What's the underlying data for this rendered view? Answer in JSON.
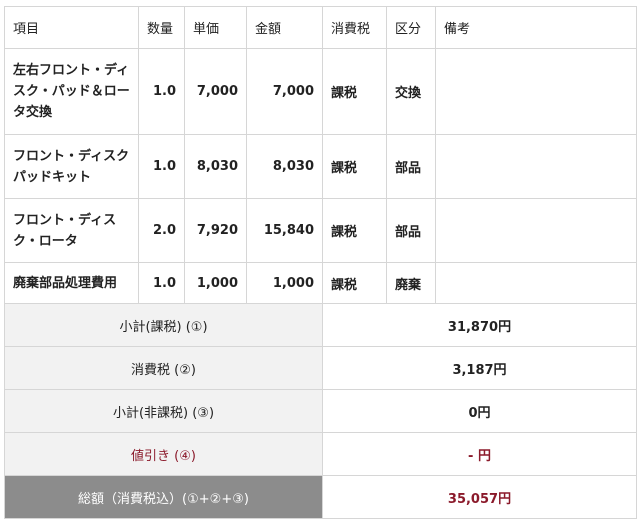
{
  "headers": [
    "項目",
    "数量",
    "単価",
    "金額",
    "消費税",
    "区分",
    "備考"
  ],
  "items": [
    {
      "name": "左右フロント・ディスク・パッド＆ロータ交換",
      "qty": "1.0",
      "unit_price": "7,000",
      "amount": "7,000",
      "tax": "課税",
      "category": "交換",
      "note": ""
    },
    {
      "name": "フロント・ディスクパッドキット",
      "qty": "1.0",
      "unit_price": "8,030",
      "amount": "8,030",
      "tax": "課税",
      "category": "部品",
      "note": ""
    },
    {
      "name": "フロント・ディスク・ロータ",
      "qty": "2.0",
      "unit_price": "7,920",
      "amount": "15,840",
      "tax": "課税",
      "category": "部品",
      "note": ""
    },
    {
      "name": "廃棄部品処理費用",
      "qty": "1.0",
      "unit_price": "1,000",
      "amount": "1,000",
      "tax": "課税",
      "category": "廃棄",
      "note": ""
    }
  ],
  "summary": {
    "subtotal_taxable": {
      "label": "小計(課税) (①)",
      "value": "31,870円"
    },
    "consumption_tax": {
      "label": "消費税 (②)",
      "value": "3,187円"
    },
    "subtotal_nontaxable": {
      "label": "小計(非課税) (③)",
      "value": "0円"
    },
    "discount": {
      "label": "値引き (④)",
      "value": "- 円"
    },
    "total": {
      "label": "総額（消費税込）(①+②+③)",
      "value": "35,057円"
    }
  }
}
